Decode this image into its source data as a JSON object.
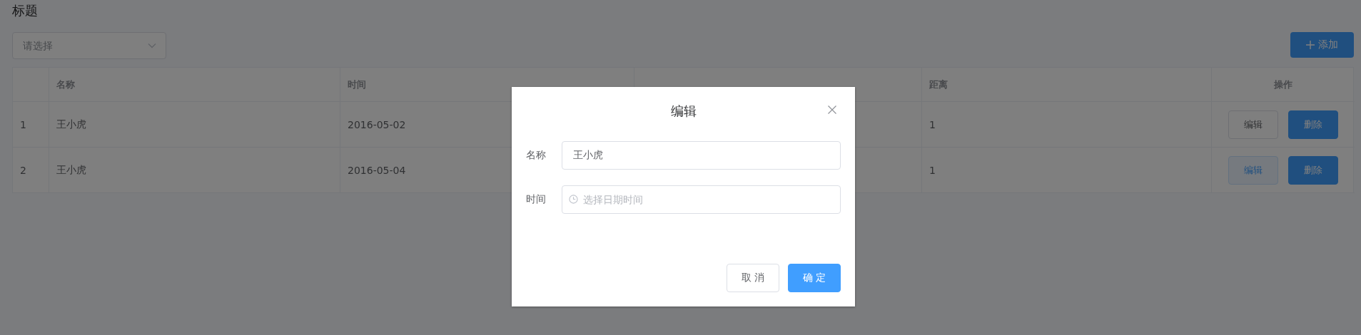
{
  "page_title": "标题",
  "filter": {
    "placeholder": "请选择"
  },
  "add_button": {
    "label": "添加"
  },
  "table": {
    "columns": [
      {
        "label": "名称"
      },
      {
        "label": "时间"
      },
      {},
      {
        "label": "距离"
      },
      {
        "label": "操作"
      }
    ],
    "rows": [
      {
        "index": "1",
        "name": "王小虎",
        "time": "2016-05-02",
        "distance": "1",
        "actions": [
          {
            "label": "编辑",
            "kind": "edit",
            "hovered": false
          },
          {
            "label": "删除",
            "kind": "delete",
            "hovered": false
          }
        ]
      },
      {
        "index": "2",
        "name": "王小虎",
        "time": "2016-05-04",
        "distance": "1",
        "actions": [
          {
            "label": "编辑",
            "kind": "edit",
            "hovered": true
          },
          {
            "label": "删除",
            "kind": "delete",
            "hovered": false
          }
        ]
      }
    ]
  },
  "dialog": {
    "title": "编辑",
    "fields": [
      {
        "kind": "text",
        "label": "名称",
        "value": "王小虎"
      },
      {
        "kind": "datetime",
        "label": "时间",
        "placeholder": "选择日期时间"
      }
    ],
    "buttons": [
      {
        "kind": "default",
        "label": "取 消"
      },
      {
        "kind": "primary",
        "label": "确 定"
      }
    ]
  }
}
